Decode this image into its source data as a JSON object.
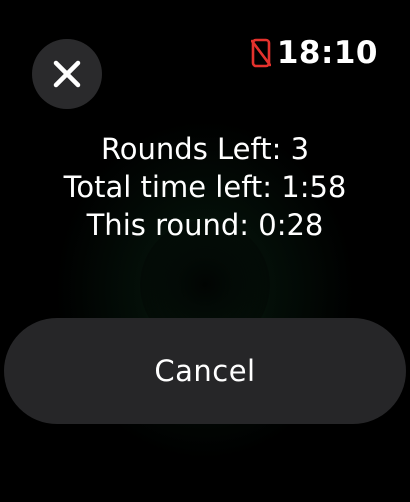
{
  "status_bar": {
    "time": "18:10",
    "phone_icon": "phone-disconnected-icon",
    "phone_icon_color": "#e5322d"
  },
  "close_button": {
    "icon": "close-icon"
  },
  "workout": {
    "rounds_left": "Rounds Left: 3",
    "total_time_left": "Total time left: 1:58",
    "this_round": "This round: 0:28"
  },
  "actions": {
    "cancel_label": "Cancel"
  },
  "colors": {
    "background": "#000000",
    "button_bg": "#262628",
    "glow": "#14462a"
  }
}
